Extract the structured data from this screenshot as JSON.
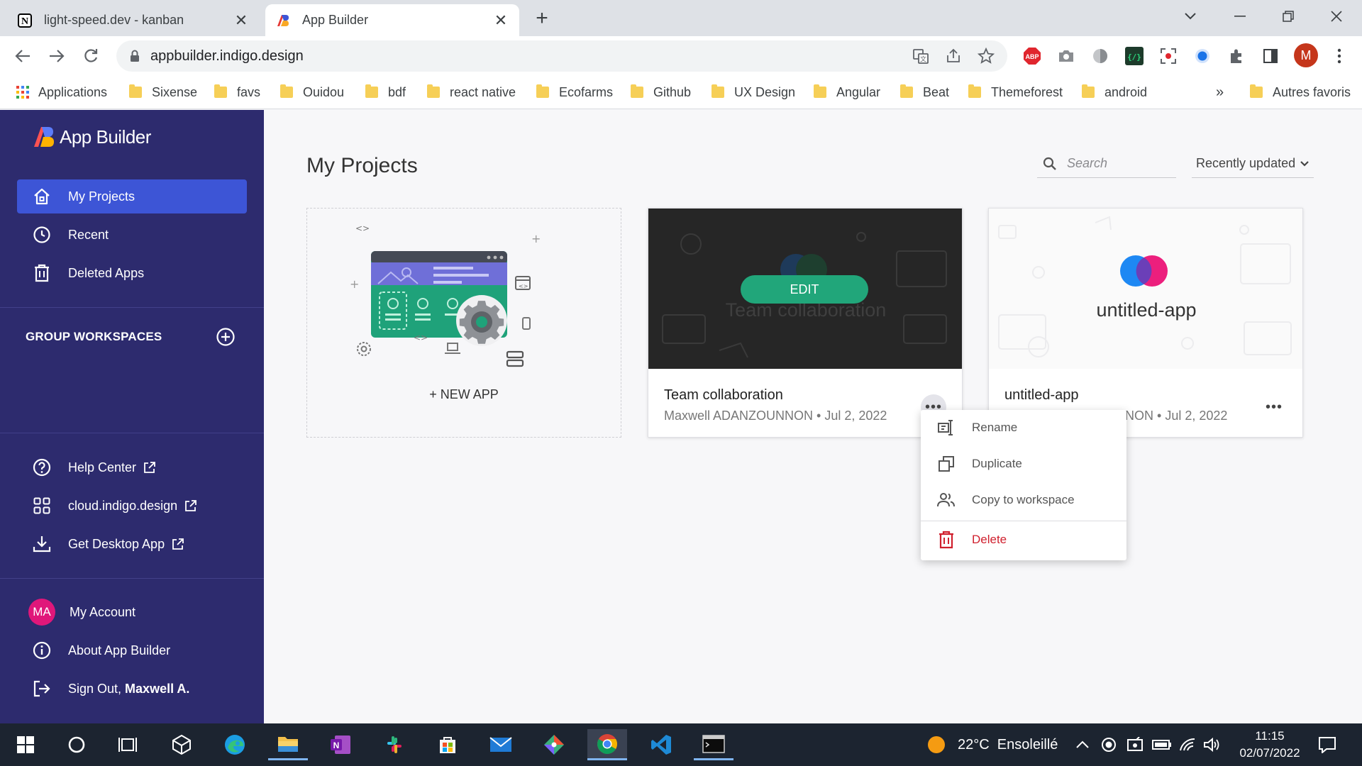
{
  "browser": {
    "tabs": [
      {
        "title": "light-speed.dev - kanban",
        "active": false
      },
      {
        "title": "App Builder",
        "active": true
      }
    ],
    "url": "appbuilder.indigo.design",
    "bookmarks": [
      "Applications",
      "Sixense",
      "favs",
      "Ouidou",
      "bdf",
      "react native",
      "Ecofarms",
      "Github",
      "UX Design",
      "Angular",
      "Beat",
      "Themeforest",
      "android"
    ],
    "overflow_label": "»",
    "other_bookmarks": "Autres favoris",
    "profile_initial": "M"
  },
  "sidebar": {
    "brand": "App Builder",
    "nav": [
      {
        "label": "My Projects",
        "icon": "home-icon",
        "active": true
      },
      {
        "label": "Recent",
        "icon": "clock-icon",
        "active": false
      },
      {
        "label": "Deleted Apps",
        "icon": "trash-icon",
        "active": false
      }
    ],
    "group_workspaces": "GROUP WORKSPACES",
    "links": [
      {
        "label": "Help Center",
        "icon": "help-icon"
      },
      {
        "label": "cloud.indigo.design",
        "icon": "grid-icon"
      },
      {
        "label": "Get Desktop App",
        "icon": "download-icon"
      }
    ],
    "account": {
      "initials": "MA",
      "label": "My Account"
    },
    "about": "About App Builder",
    "signout_prefix": "Sign Out, ",
    "signout_name": "Maxwell A."
  },
  "main": {
    "title": "My Projects",
    "search_placeholder": "Search",
    "sort": "Recently updated",
    "new_app_label": "+ NEW APP",
    "projects": [
      {
        "name": "Team collaboration",
        "author": "Maxwell ADANZOUNNON",
        "sep": "•",
        "date": "Jul 2, 2022",
        "thumb_title": "Team collaboration",
        "edit_label": "EDIT"
      },
      {
        "name": "untitled-app",
        "author": "Maxwell ADANZOUNNON",
        "visible_author": "NNON",
        "sep": "•",
        "date": "Jul 2, 2022",
        "thumb_title": "untitled-app"
      }
    ],
    "more_label": "•••"
  },
  "context_menu": {
    "items": [
      {
        "label": "Rename",
        "icon": "rename-icon"
      },
      {
        "label": "Duplicate",
        "icon": "duplicate-icon"
      },
      {
        "label": "Copy to workspace",
        "icon": "users-icon"
      },
      {
        "label": "Delete",
        "icon": "trash-icon",
        "danger": true
      }
    ]
  },
  "taskbar": {
    "weather": "22°C  Ensoleillé",
    "time": "11:15",
    "date": "02/07/2022"
  },
  "colors": {
    "sidebar": "#2d2b6e",
    "sidebar_active": "#3d55d6",
    "edit_button": "#21a67a",
    "danger": "#d0202e",
    "avatar": "#e0177a"
  }
}
